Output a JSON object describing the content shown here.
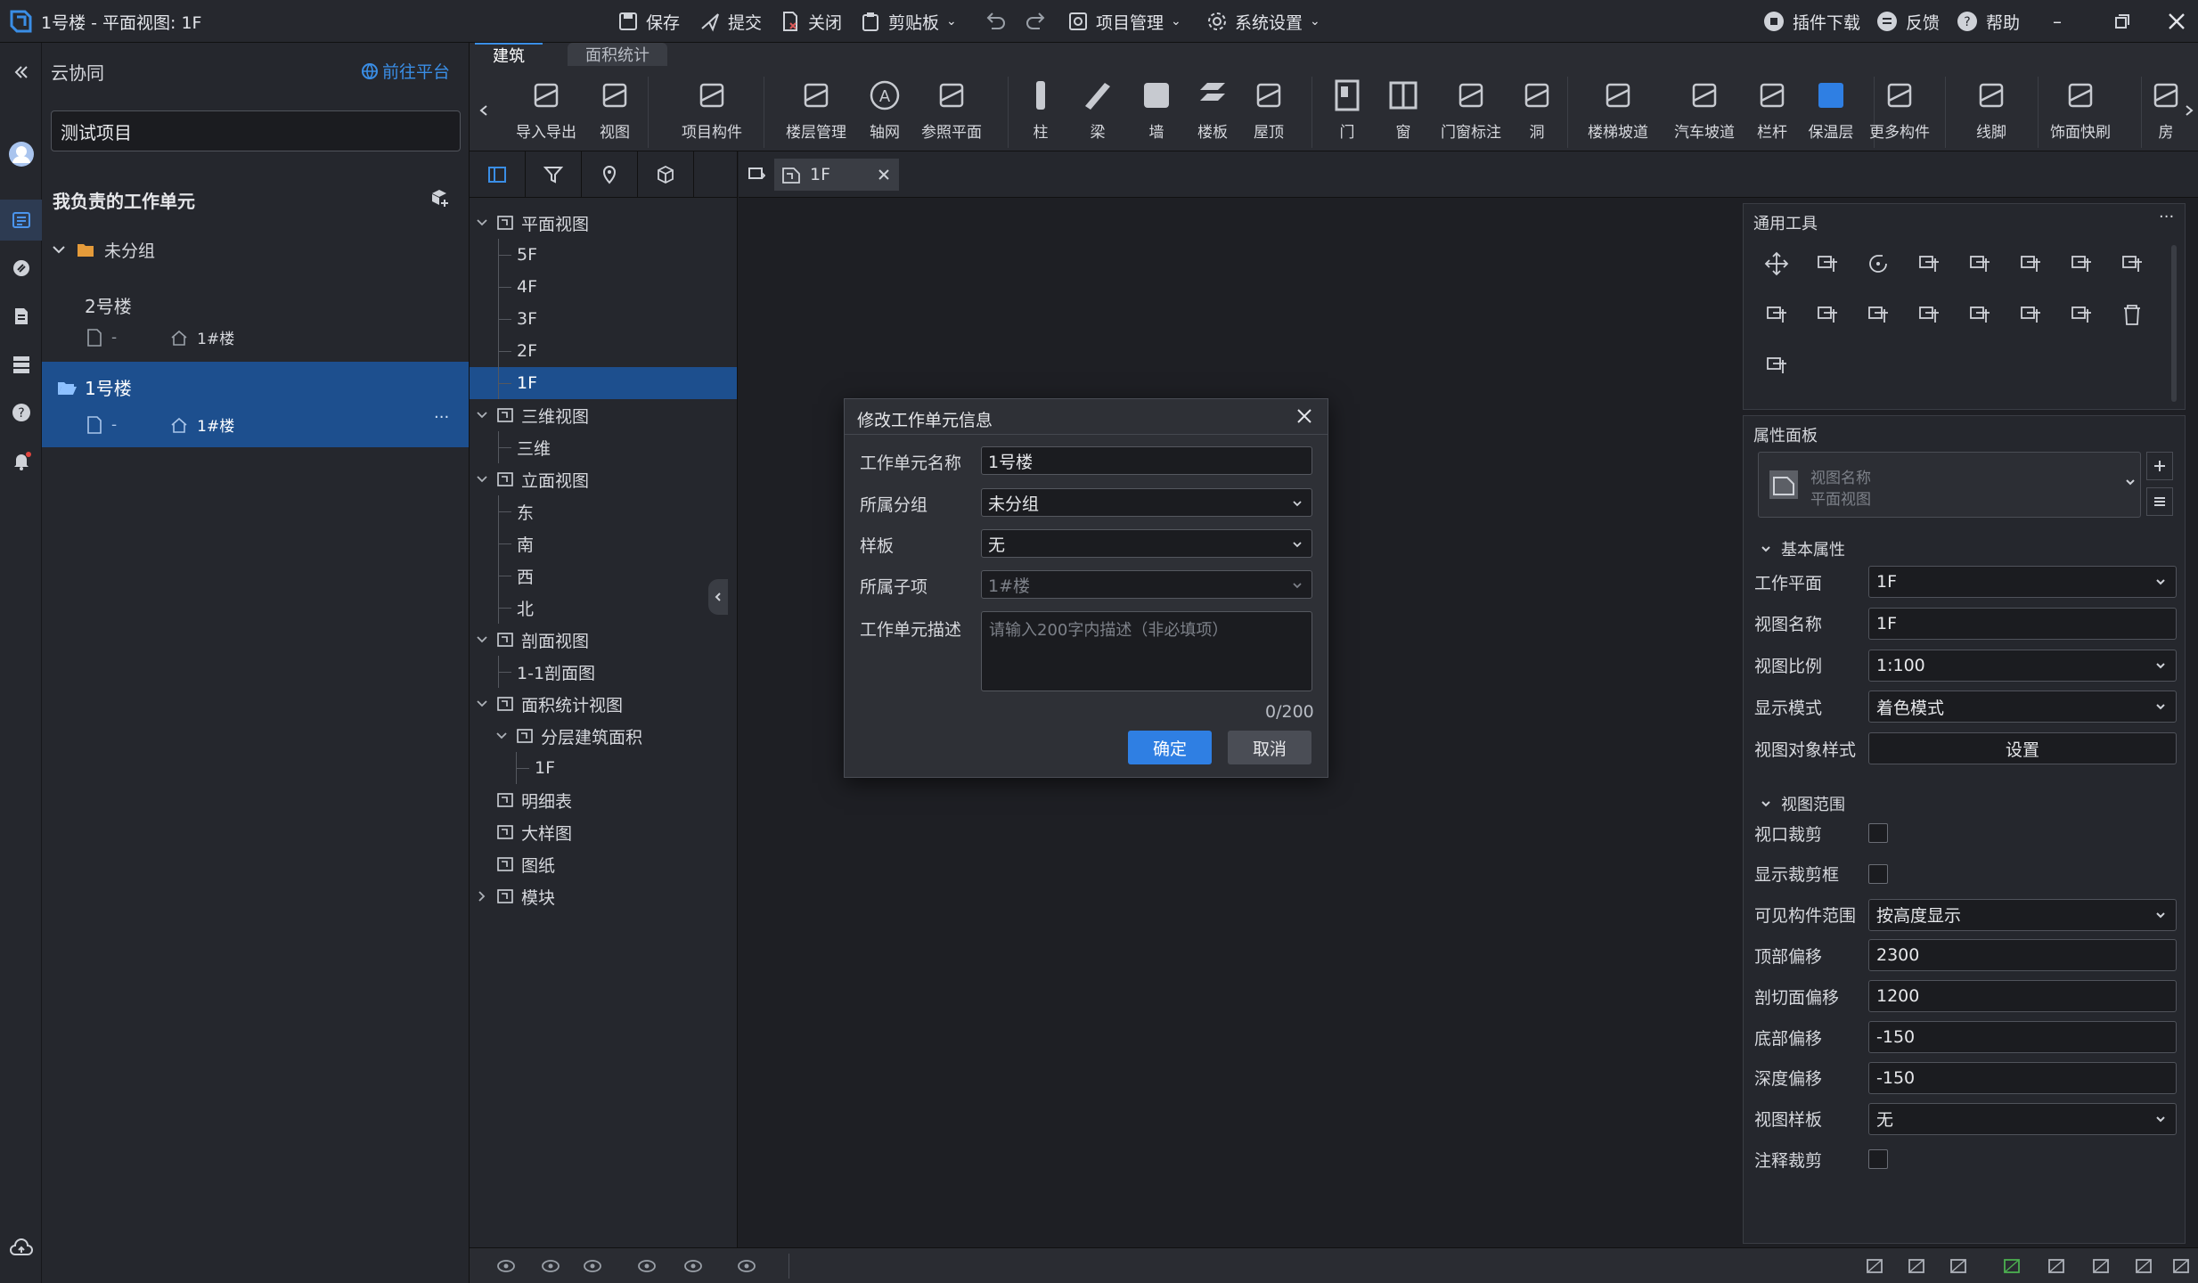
{
  "titlebar": {
    "title": "1号楼 - 平面视图: 1F",
    "save": "保存",
    "submit": "提交",
    "close": "关闭",
    "clipboard": "剪贴板",
    "project_manage": "项目管理",
    "system_settings": "系统设置",
    "plugin_download": "插件下载",
    "feedback": "反馈",
    "help": "帮助"
  },
  "left": {
    "header": "云协同",
    "goto_platform": "前往平台",
    "project_name": "测试项目",
    "section_title": "我负责的工作单元",
    "group_name": "未分组",
    "units": [
      {
        "name": "2号楼",
        "dash": "-",
        "sub": "1#楼"
      },
      {
        "name": "1号楼",
        "dash": "-",
        "sub": "1#楼",
        "more": "···"
      }
    ]
  },
  "ribbon": {
    "tabs": [
      "建筑",
      "面积统计"
    ],
    "buttons": [
      "导入导出",
      "视图",
      "项目构件",
      "楼层管理",
      "轴网",
      "参照平面",
      "柱",
      "梁",
      "墙",
      "楼板",
      "屋顶",
      "门",
      "窗",
      "门窗标注",
      "洞",
      "楼梯坡道",
      "汽车坡道",
      "栏杆",
      "保温层",
      "更多构件",
      "线脚",
      "饰面快刷",
      "房"
    ]
  },
  "tree": {
    "nodes": [
      {
        "label": "平面视图",
        "level": 0,
        "expanded": true
      },
      {
        "label": "5F",
        "level": 1
      },
      {
        "label": "4F",
        "level": 1
      },
      {
        "label": "3F",
        "level": 1
      },
      {
        "label": "2F",
        "level": 1
      },
      {
        "label": "1F",
        "level": 1,
        "selected": true
      },
      {
        "label": "三维视图",
        "level": 0,
        "expanded": true
      },
      {
        "label": "三维",
        "level": 1
      },
      {
        "label": "立面视图",
        "level": 0,
        "expanded": true
      },
      {
        "label": "东",
        "level": 1
      },
      {
        "label": "南",
        "level": 1
      },
      {
        "label": "西",
        "level": 1
      },
      {
        "label": "北",
        "level": 1
      },
      {
        "label": "剖面视图",
        "level": 0,
        "expanded": true
      },
      {
        "label": "1-1剖面图",
        "level": 1
      },
      {
        "label": "面积统计视图",
        "level": 0,
        "expanded": true
      },
      {
        "label": "分层建筑面积",
        "level": 1,
        "expanded": true
      },
      {
        "label": "1F",
        "level": 2
      },
      {
        "label": "明细表",
        "level": 0
      },
      {
        "label": "大样图",
        "level": 0
      },
      {
        "label": "图纸",
        "level": 0
      },
      {
        "label": "模块",
        "level": 0,
        "collapsed": true
      }
    ]
  },
  "view_tab": {
    "label": "1F"
  },
  "tools_panel": {
    "title": "通用工具",
    "more": "···"
  },
  "properties": {
    "title": "属性面板",
    "type_name": "视图名称",
    "type_sub": "平面视图",
    "basic_section": "基本属性",
    "rows": [
      {
        "label": "工作平面",
        "value": "1F",
        "kind": "select"
      },
      {
        "label": "视图名称",
        "value": "1F",
        "kind": "input"
      },
      {
        "label": "视图比例",
        "value": "1:100",
        "kind": "select"
      },
      {
        "label": "显示模式",
        "value": "着色模式",
        "kind": "select"
      },
      {
        "label": "视图对象样式",
        "value": "设置",
        "kind": "button"
      }
    ],
    "range_section": "视图范围",
    "range_rows": [
      {
        "label": "视口裁剪",
        "kind": "check"
      },
      {
        "label": "显示裁剪框",
        "kind": "check"
      },
      {
        "label": "可见构件范围",
        "value": "按高度显示",
        "kind": "select"
      },
      {
        "label": "顶部偏移",
        "value": "2300",
        "kind": "input"
      },
      {
        "label": "剖切面偏移",
        "value": "1200",
        "kind": "input"
      },
      {
        "label": "底部偏移",
        "value": "-150",
        "kind": "input"
      },
      {
        "label": "深度偏移",
        "value": "-150",
        "kind": "input"
      },
      {
        "label": "视图样板",
        "value": "无",
        "kind": "select"
      },
      {
        "label": "注释裁剪",
        "kind": "check"
      }
    ]
  },
  "dialog": {
    "title": "修改工作单元信息",
    "name_label": "工作单元名称",
    "name_value": "1号楼",
    "group_label": "所属分组",
    "group_value": "未分组",
    "template_label": "样板",
    "template_value": "无",
    "sub_label": "所属子项",
    "sub_value": "1#楼",
    "desc_label": "工作单元描述",
    "desc_placeholder": "请输入200字内描述（非必填项）",
    "counter": "0/200",
    "ok": "确定",
    "cancel": "取消"
  },
  "colors": {
    "accent": "#1f6fd0",
    "selected_row": "#1d4f8e",
    "bg": "#1e1f24"
  }
}
